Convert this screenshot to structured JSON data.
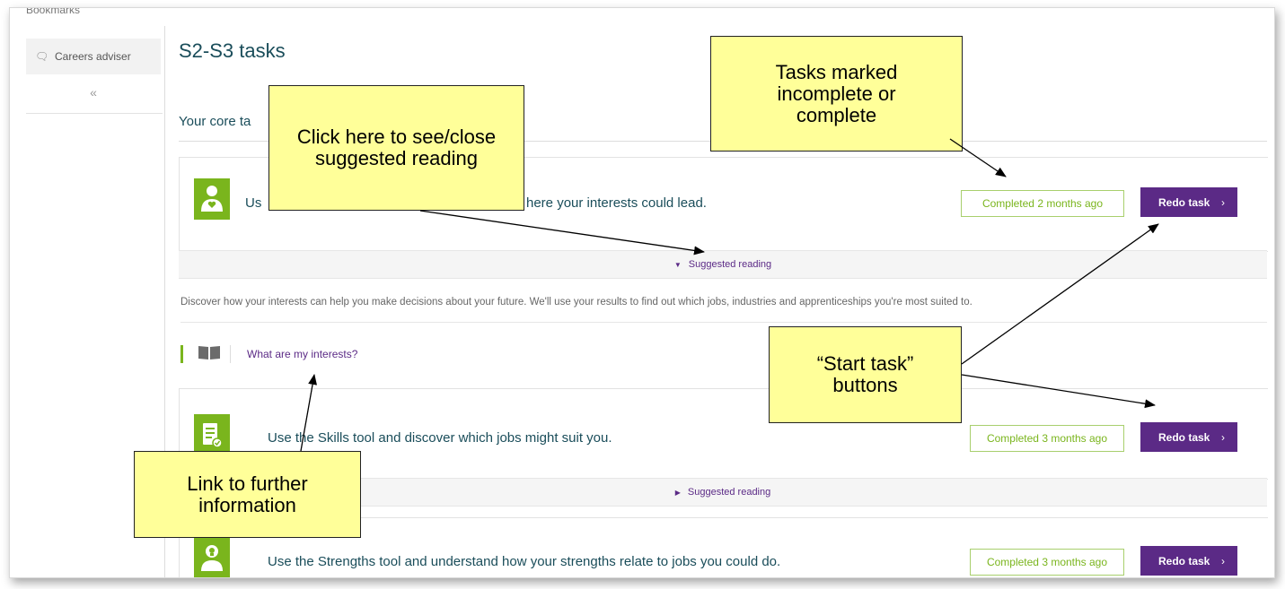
{
  "sidebar": {
    "top_item": "Bookmarks",
    "careers_adviser": "Careers adviser",
    "collapse": "«"
  },
  "page": {
    "title": "S2-S3 tasks",
    "core_label": "Your core ta"
  },
  "tasks": [
    {
      "text_pre": "Us",
      "text_post": "here your interests could lead.",
      "status": "Completed 2 months ago",
      "button": "Redo task",
      "chevron": "›",
      "icon": "person-heart-icon"
    },
    {
      "text": "Use the Skills tool and discover which jobs might suit you.",
      "status": "Completed 3 months ago",
      "button": "Redo task",
      "chevron": "›",
      "icon": "clipboard-check-icon"
    },
    {
      "text": "Use the Strengths tool and understand how your strengths relate to jobs you could do.",
      "status": "Completed 3 months ago",
      "button": "Redo task",
      "chevron": "›",
      "icon": "person-bulb-icon"
    }
  ],
  "reading": {
    "label": "Suggested reading",
    "description": "Discover how your interests can help you make decisions about your future. We'll use your results to find out which jobs, industries and apprenticeships you're most suited to.",
    "link": "What are my interests?"
  },
  "callouts": {
    "click_here": "Click here to see/close suggested reading",
    "tasks_marked": "Tasks marked incomplete or complete",
    "start_task": "“Start task” buttons",
    "link_info": "Link to further information"
  },
  "colors": {
    "green": "#7ab51d",
    "purple": "#5b2a86",
    "teal": "#1a4d5a",
    "callout": "#ffff99"
  }
}
